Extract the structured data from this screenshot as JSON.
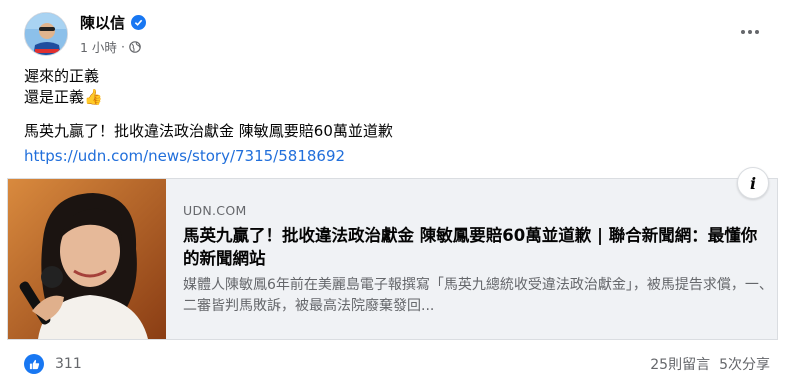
{
  "post": {
    "author": "陳以信",
    "time": "1 小時",
    "text_lines": [
      "遲來的正義",
      "還是正義👍"
    ],
    "headline": "馬英九贏了！批收違法政治獻金 陳敏鳳要賠60萬並道歉",
    "url": "https://udn.com/news/story/7315/5818692"
  },
  "link_card": {
    "source": "UDN.COM",
    "title": "馬英九贏了！批收違法政治獻金 陳敏鳳要賠60萬並道歉 | 聯合新聞網：最懂你的新聞網站",
    "description": "媒體人陳敏鳳6年前在美麗島電子報撰寫「馬英九總統收受違法政治獻金」，被馬提告求償，一、二審皆判馬敗訴，被最高法院廢棄發回...",
    "info_label": "i"
  },
  "footer": {
    "like_count": "311",
    "comments": "25則留言",
    "shares": "5次分享"
  },
  "colors": {
    "link": "#216fdb",
    "accent": "#1877f2",
    "secondary_text": "#65676b"
  },
  "icons": {
    "verified": "verified-badge-icon",
    "audience": "globe-icon",
    "menu": "more-options-icon",
    "reaction": "like-icon"
  }
}
